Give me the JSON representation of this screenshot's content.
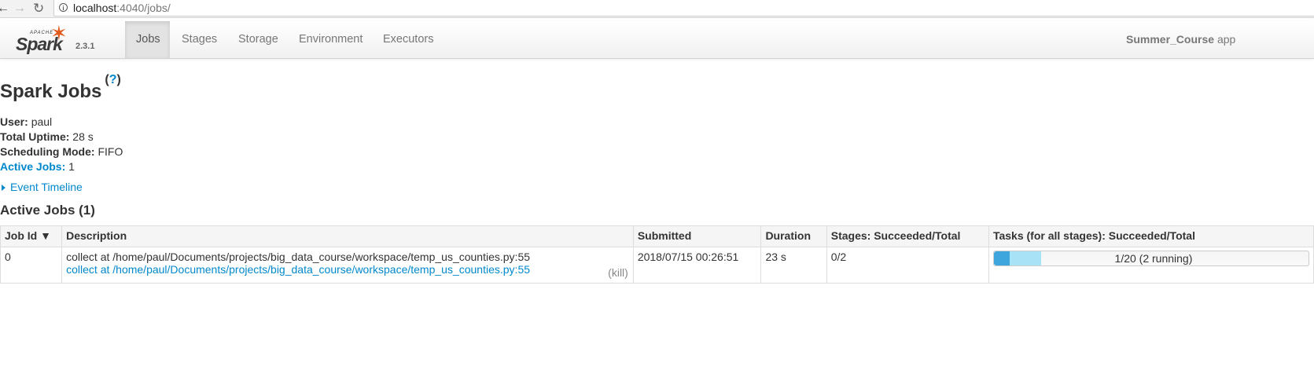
{
  "browser": {
    "url_host": "localhost",
    "url_rest": ":4040/jobs/"
  },
  "navbar": {
    "logo_top": "APACHE",
    "logo_text": "Spark",
    "version": "2.3.1",
    "tabs": [
      {
        "label": "Jobs",
        "active": true
      },
      {
        "label": "Stages"
      },
      {
        "label": "Storage"
      },
      {
        "label": "Environment"
      },
      {
        "label": "Executors"
      }
    ],
    "app_name": "Summer_Course",
    "app_suffix": "app"
  },
  "page": {
    "title": "Spark Jobs",
    "help": "?",
    "summary": {
      "user_label": "User:",
      "user": "paul",
      "uptime_label": "Total Uptime:",
      "uptime": "28 s",
      "scheduling_label": "Scheduling Mode:",
      "scheduling": "FIFO",
      "active_jobs_label": "Active Jobs:",
      "active_jobs": "1"
    },
    "event_timeline": "Event Timeline",
    "section_title": "Active Jobs (1)"
  },
  "table": {
    "headers": [
      "Job Id ▼",
      "Description",
      "Submitted",
      "Duration",
      "Stages: Succeeded/Total",
      "Tasks (for all stages): Succeeded/Total"
    ],
    "rows": [
      {
        "job_id": "0",
        "description": "collect at /home/paul/Documents/projects/big_data_course/workspace/temp_us_counties.py:55",
        "description_link": "collect at /home/paul/Documents/projects/big_data_course/workspace/temp_us_counties.py:55",
        "kill": "(kill)",
        "submitted": "2018/07/15 00:26:51",
        "duration": "23 s",
        "stages": "0/2",
        "tasks_text": "1/20 (2 running)",
        "tasks_succeeded": 1,
        "tasks_running": 2,
        "tasks_total": 20
      }
    ]
  },
  "colors": {
    "link": "#0088cc",
    "progress_done": "#3ea5dd",
    "progress_running": "#a7e2f7",
    "spark_orange": "#e25a1c"
  }
}
